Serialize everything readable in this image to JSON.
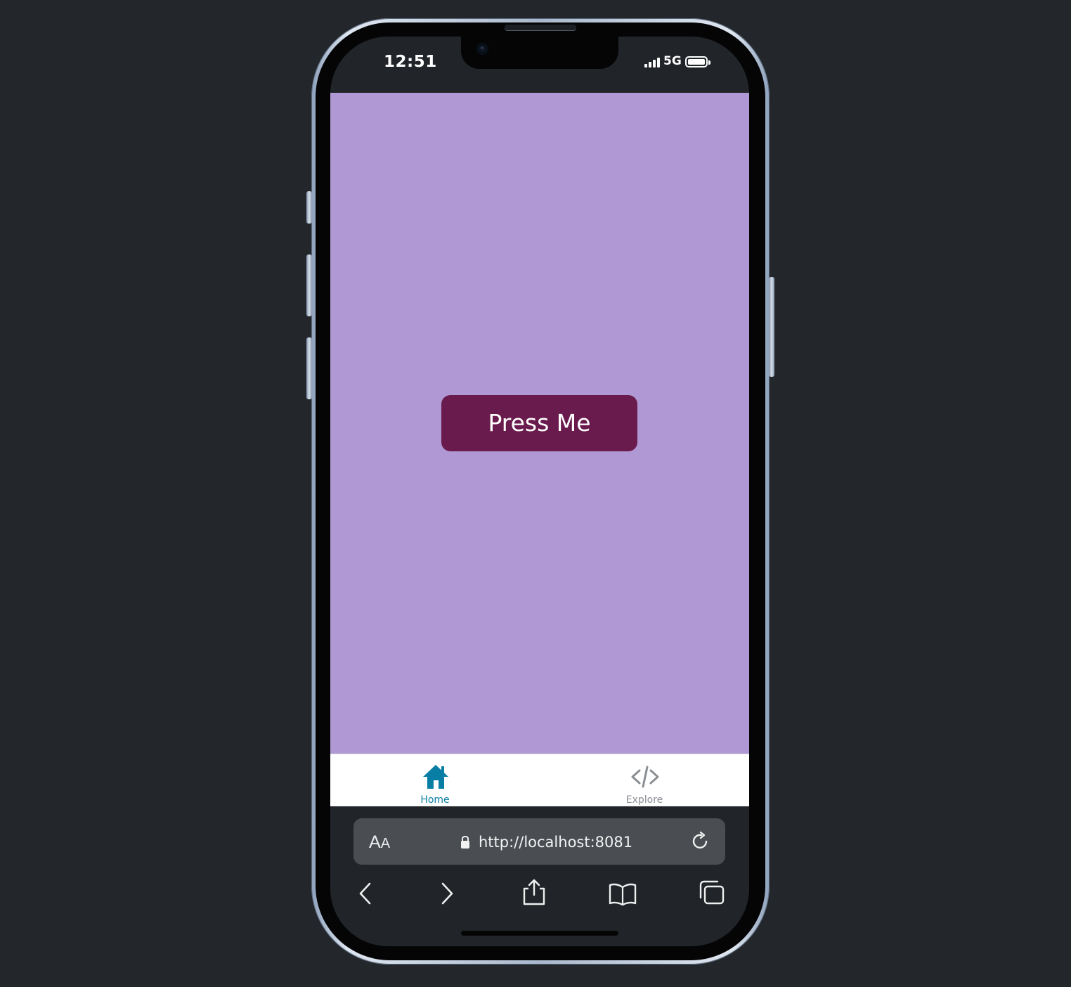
{
  "status_bar": {
    "time": "12:51",
    "network": "5G"
  },
  "app": {
    "background_color": "#af98d3",
    "button_color": "#6a1b4d",
    "press_button_label": "Press Me"
  },
  "tab_bar": {
    "active_color": "#087ea4",
    "inactive_color": "#8b8f94",
    "items": [
      {
        "label": "Home",
        "icon": "home-icon",
        "active": true
      },
      {
        "label": "Explore",
        "icon": "code-icon",
        "active": false
      }
    ]
  },
  "browser": {
    "reader_label": "AA",
    "url": "http://localhost:8081",
    "toolbar_icons": [
      "back-icon",
      "forward-icon",
      "share-icon",
      "bookmarks-icon",
      "tabs-icon"
    ]
  }
}
